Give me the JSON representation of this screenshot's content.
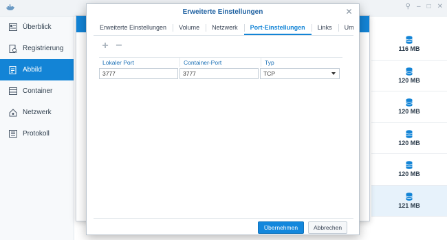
{
  "colors": {
    "accent": "#1384d6",
    "title": "#1c5fa0",
    "sidebar_active": "#1384d6"
  },
  "sidebar": {
    "items": [
      {
        "label": "Überblick",
        "icon": "overview-icon",
        "active": false
      },
      {
        "label": "Registrierung",
        "icon": "registry-icon",
        "active": false
      },
      {
        "label": "Abbild",
        "icon": "image-icon",
        "active": true
      },
      {
        "label": "Container",
        "icon": "container-icon",
        "active": false
      },
      {
        "label": "Netzwerk",
        "icon": "network-icon",
        "active": false
      },
      {
        "label": "Protokoll",
        "icon": "log-icon",
        "active": false
      }
    ]
  },
  "image_sizes": [
    "116 MB",
    "120 MB",
    "120 MB",
    "120 MB",
    "120 MB",
    "121 MB"
  ],
  "dialog": {
    "title": "Erweiterte Einstellungen",
    "tabs": [
      "Erweiterte Einstellungen",
      "Volume",
      "Netzwerk",
      "Port-Einstellungen",
      "Links",
      "Umgebung"
    ],
    "active_tab": "Port-Einstellungen",
    "toolbar": {
      "add": "+",
      "remove": "−"
    },
    "grid": {
      "headers": [
        "Lokaler Port",
        "Container-Port",
        "Typ"
      ],
      "rows": [
        {
          "local_port": "3777",
          "container_port": "3777",
          "type": "TCP"
        }
      ]
    },
    "buttons": {
      "apply": "Übernehmen",
      "cancel": "Abbrechen"
    }
  }
}
